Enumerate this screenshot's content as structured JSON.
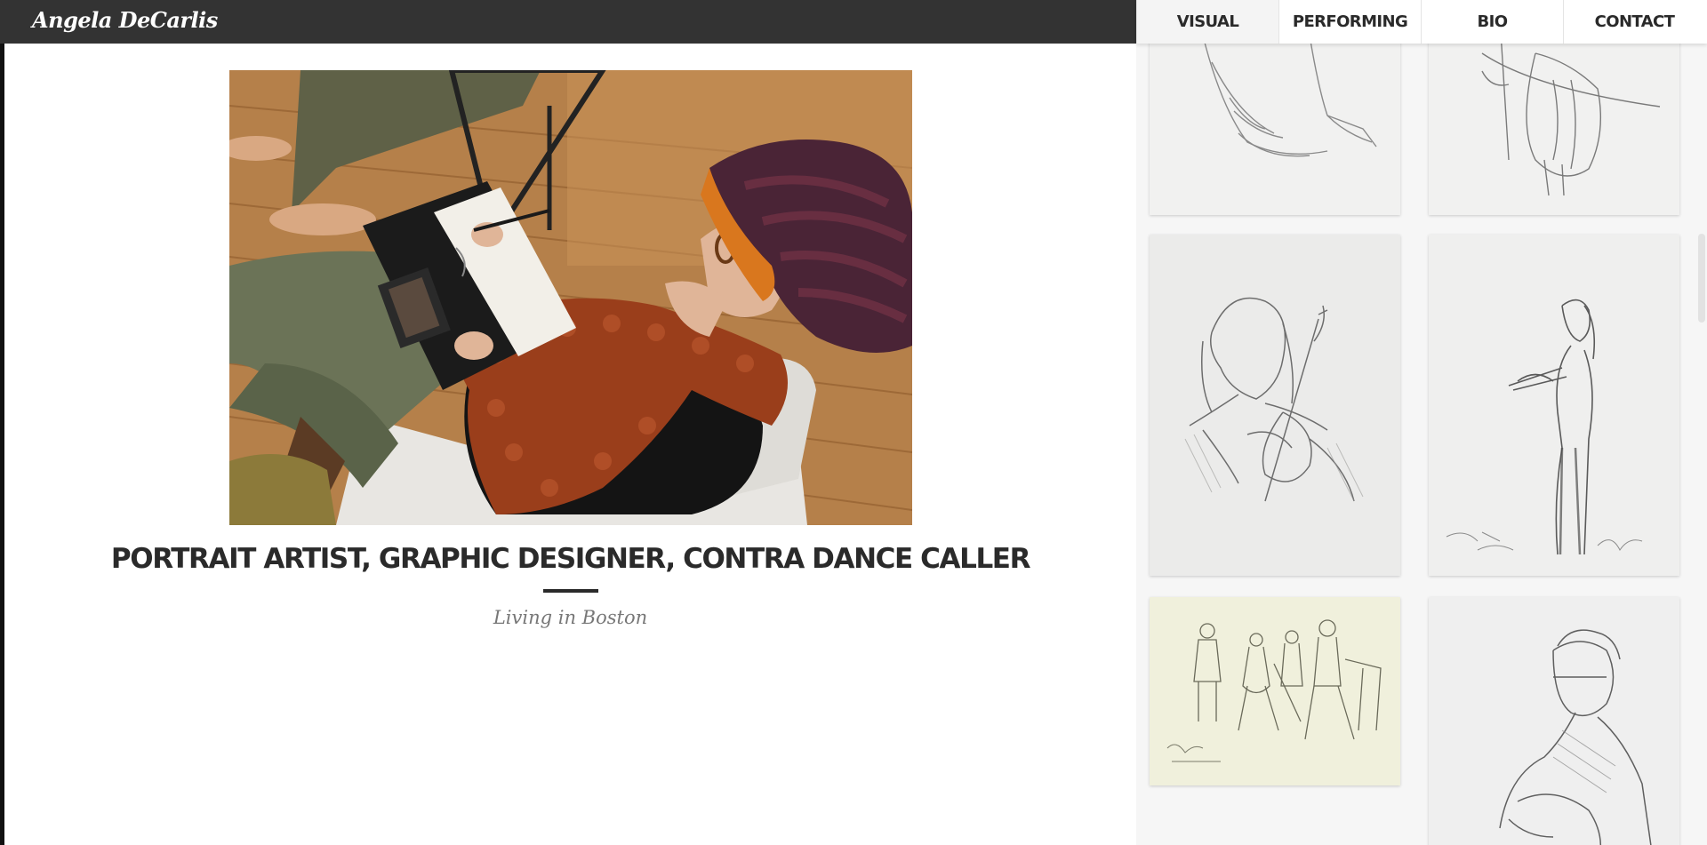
{
  "brand": {
    "logo_text": "Angela DeCarlis"
  },
  "nav": {
    "items": [
      {
        "label": "VISUAL"
      },
      {
        "label": "PERFORMING"
      },
      {
        "label": "BIO"
      },
      {
        "label": "CONTACT"
      }
    ]
  },
  "hero": {
    "title": "PORTRAIT ARTIST, GRAPHIC DESIGNER, CONTRA DANCE CALLER",
    "subtitle": "Living in Boston"
  },
  "colors": {
    "brand_bar": "#333333",
    "text_dark": "#2a2a2a",
    "subtitle": "#777777",
    "gallery_bg": "#f6f6f6"
  },
  "icons": {
    "hero_photo": "artist-sketching-photo",
    "thumbnails": "pencil-sketch-thumbnail"
  }
}
